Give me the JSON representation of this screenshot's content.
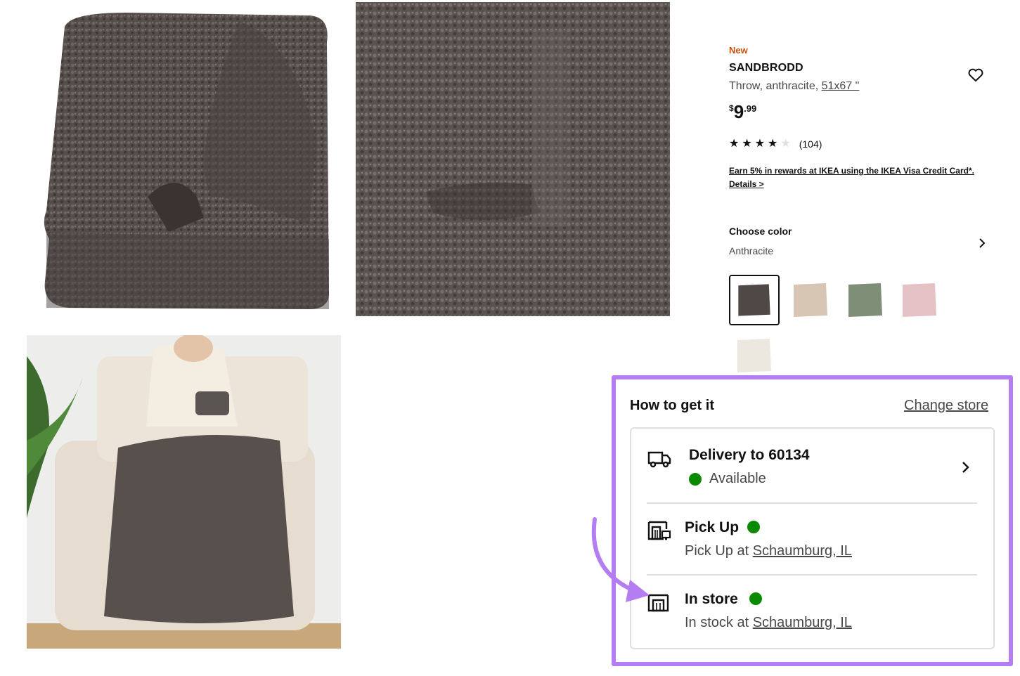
{
  "product": {
    "badge": "New",
    "name": "SANDBRODD",
    "description_prefix": "Throw, anthracite, ",
    "size": "51x67 \"",
    "price": {
      "currency": "$",
      "integer": "9",
      "decimal": ".99"
    },
    "rating": {
      "stars": 4,
      "max": 5,
      "review_count": "(104)"
    },
    "rewards_text": "Earn 5% in rewards at IKEA using the IKEA Visa Credit Card*. Details >",
    "wishlist_icon": "heart-icon"
  },
  "color_picker": {
    "title": "Choose color",
    "selected": "Anthracite",
    "swatches": [
      {
        "name": "Anthracite",
        "color": "#4f4846"
      },
      {
        "name": "Beige",
        "color": "#d8c6b4"
      },
      {
        "name": "Green",
        "color": "#7f8f77"
      },
      {
        "name": "Pink",
        "color": "#e4c1c5"
      },
      {
        "name": "White",
        "color": "#ece8df"
      }
    ]
  },
  "how_to_get_it": {
    "title": "How to get it",
    "change_store": "Change store",
    "delivery": {
      "title": "Delivery to 60134",
      "status": "Available",
      "icon": "truck-icon"
    },
    "pickup": {
      "title": "Pick Up",
      "prefix": "Pick Up at ",
      "store": "Schaumburg, IL",
      "icon": "pickup-store-icon"
    },
    "in_store": {
      "title": "In store",
      "prefix": "In stock at ",
      "store": "Schaumburg, IL",
      "icon": "store-icon"
    },
    "status_color": "#0a8a00",
    "highlight_color": "#b47df2"
  }
}
